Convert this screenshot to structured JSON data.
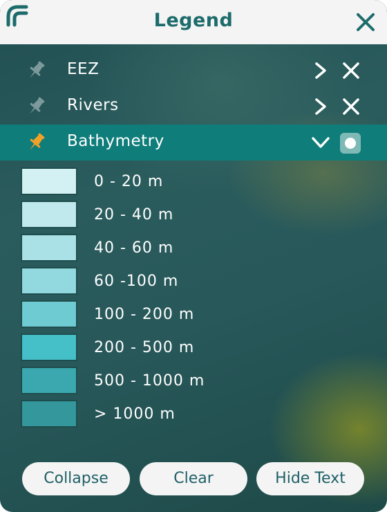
{
  "header": {
    "title": "Legend"
  },
  "layers": [
    {
      "label": "EEZ",
      "pinned": false,
      "expanded": false
    },
    {
      "label": "Rivers",
      "pinned": false,
      "expanded": false
    },
    {
      "label": "Bathymetry",
      "pinned": true,
      "expanded": true
    }
  ],
  "legend_items": [
    {
      "label": "0 - 20 m",
      "color": "#d3f1f2"
    },
    {
      "label": "20 - 40 m",
      "color": "#bfe9ec"
    },
    {
      "label": "40 - 60 m",
      "color": "#a9e1e6"
    },
    {
      "label": "60 -100 m",
      "color": "#92d8df"
    },
    {
      "label": "100 - 200 m",
      "color": "#6fcbd2"
    },
    {
      "label": "200 - 500 m",
      "color": "#45c0c8"
    },
    {
      "label": "500 - 1000 m",
      "color": "#3aa8ae"
    },
    {
      "label": "> 1000 m",
      "color": "#34979c"
    }
  ],
  "footer": {
    "collapse_label": "Collapse",
    "clear_label": "Clear",
    "hide_text_label": "Hide Text"
  },
  "colors": {
    "accent": "#0f7d7a",
    "pin_active": "#f2a127",
    "pin_inactive": "#7e9a9c",
    "header_text": "#1d6b6b"
  }
}
